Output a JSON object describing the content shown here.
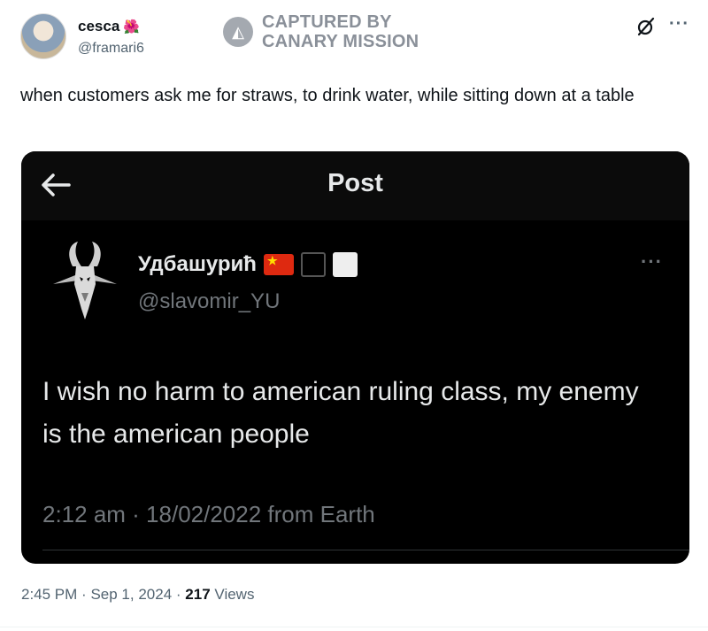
{
  "author": {
    "name": "cesca",
    "name_emoji": "🌺",
    "handle": "@framari6"
  },
  "watermark": {
    "line1": "CAPTURED BY",
    "line2": "CANARY MISSION"
  },
  "tweet": {
    "text": "when customers ask me for straws, to drink water, while sitting down at a table",
    "time": "2:45 PM",
    "separator": "·",
    "date": "Sep 1, 2024",
    "views_count": "217",
    "views_label": "Views"
  },
  "embedded_screenshot": {
    "header_title": "Post",
    "author_name": "Удбашурић",
    "handle": "@slavomir_YU",
    "text": "I wish no harm to american ruling class, my enemy is the american people",
    "meta": "2:12 am · 18/02/2022 from Earth",
    "colors": {
      "background": "#000000",
      "text": "#e7e9ea",
      "muted": "#71767b"
    }
  },
  "icons": {
    "grok": "grok-icon",
    "more": "more-icon",
    "back": "back-arrow-icon",
    "flag": "china-flag-icon",
    "black_square": "black-square-icon",
    "white_square": "white-square-icon"
  }
}
